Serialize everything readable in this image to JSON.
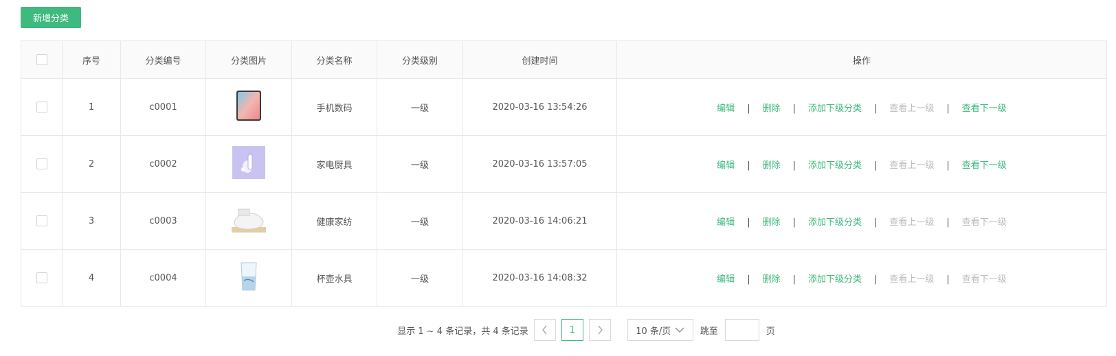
{
  "toolbar": {
    "add_label": "新增分类"
  },
  "table": {
    "headers": {
      "index": "序号",
      "code": "分类编号",
      "image": "分类图片",
      "name": "分类名称",
      "level": "分类级别",
      "created": "创建时间",
      "actions": "操作"
    },
    "rows": [
      {
        "index": "1",
        "code": "c0001",
        "image_icon": "phone-icon",
        "name": "手机数码",
        "level": "一级",
        "created": "2020-03-16 13:54:26",
        "view_child_enabled": true
      },
      {
        "index": "2",
        "code": "c0002",
        "image_icon": "appliance-icon",
        "name": "家电厨具",
        "level": "一级",
        "created": "2020-03-16 13:57:05",
        "view_child_enabled": true
      },
      {
        "index": "3",
        "code": "c0003",
        "image_icon": "pillow-icon",
        "name": "健康家纺",
        "level": "一级",
        "created": "2020-03-16 14:06:21",
        "view_child_enabled": false
      },
      {
        "index": "4",
        "code": "c0004",
        "image_icon": "glass-icon",
        "name": "杯壶水具",
        "level": "一级",
        "created": "2020-03-16 14:08:32",
        "view_child_enabled": false
      }
    ],
    "row_actions": {
      "edit": "编辑",
      "delete": "删除",
      "add_child": "添加下级分类",
      "view_parent": "查看上一级",
      "view_child": "查看下一级",
      "separator": "|"
    }
  },
  "pagination": {
    "info": "显示 1 ~ 4 条记录，共 4 条记录",
    "current_page": "1",
    "page_size": "10 条/页",
    "jump_label": "跳至",
    "page_unit": "页"
  },
  "colors": {
    "accent": "#3fba7e",
    "disabled": "#bdbdbd"
  }
}
